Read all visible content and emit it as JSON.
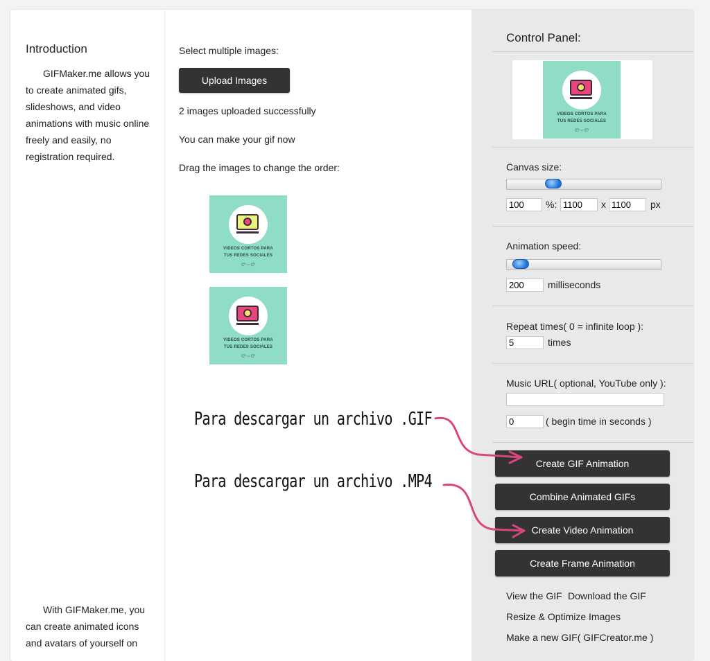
{
  "intro": {
    "title": "Introduction",
    "paragraph1": "GIFMaker.me allows you to create animated gifs, slideshows, and video animations with music online freely and easily, no registration required.",
    "paragraph2": "With GIFMaker.me, you can create animated icons and avatars of yourself on"
  },
  "upload": {
    "prompt": "Select multiple images:",
    "button_label": "Upload Images",
    "status": "2 images uploaded successfully",
    "ready": "You can make your gif now",
    "drag_hint": "Drag the images to change the order:"
  },
  "thumbnails": [
    {
      "line1": "VIDEOS CORTOS PARA",
      "line2": "TUS REDES SOCIALES",
      "signature": "ლ·ᴗ·ლ",
      "play_color": "#f7e36b"
    },
    {
      "line1": "VIDEOS CORTOS PARA",
      "line2": "TUS REDES SOCIALES",
      "signature": "ლ·ᴗ·ლ",
      "play_color": "#f7e36b"
    }
  ],
  "preview": {
    "line1": "VIDEOS CORTOS PARA",
    "line2": "TUS REDES SOCIALES",
    "signature": "ლ·ᴗ·ლ"
  },
  "annotations": {
    "gif": "Para descargar un archivo .GIF",
    "mp4": "Para descargar un archivo .MP4",
    "arrow_color": "#d9457f"
  },
  "control_panel": {
    "title": "Control Panel:",
    "canvas": {
      "label": "Canvas size:",
      "slider_level": 0.28,
      "percent": "100",
      "percent_unit": "%:",
      "width": "1100",
      "times": "x",
      "height": "1100",
      "px": "px"
    },
    "speed": {
      "label": "Animation speed:",
      "slider_level": 0.04,
      "value": "200",
      "unit": "milliseconds"
    },
    "repeat": {
      "label": "Repeat times( 0 = infinite loop ):",
      "value": "5",
      "unit": "times"
    },
    "music": {
      "label": "Music URL( optional, YouTube only ):",
      "url": "",
      "begin": "0",
      "begin_unit": "( begin time in seconds )"
    },
    "buttons": {
      "create_gif": "Create GIF Animation",
      "combine": "Combine Animated GIFs",
      "create_video": "Create Video Animation",
      "create_frame": "Create Frame Animation"
    },
    "links": {
      "view": "View the GIF",
      "download": "Download the GIF",
      "resize": "Resize & Optimize Images",
      "new_gif": "Make a new GIF( GIFCreator.me )"
    }
  }
}
